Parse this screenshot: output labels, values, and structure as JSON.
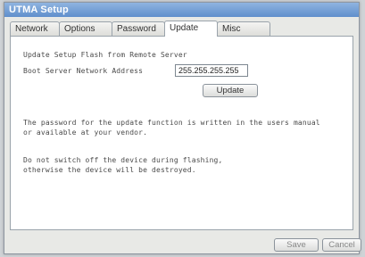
{
  "window": {
    "title": "UTMA Setup"
  },
  "tabs": [
    {
      "label": "Network"
    },
    {
      "label": "Options"
    },
    {
      "label": "Password"
    },
    {
      "label": "Update"
    },
    {
      "label": "Misc"
    }
  ],
  "active_tab": "Update",
  "update": {
    "heading": "Update Setup Flash from Remote Server",
    "address_label": "Boot Server Network Address",
    "address_value": "255.255.255.255",
    "update_button": "Update",
    "note1_line1": "The password for the update function is written in the users manual",
    "note1_line2": "or available at your vendor.",
    "note2_line1": "Do not switch off the device during flashing,",
    "note2_line2": "otherwise the device will be destroyed."
  },
  "footer": {
    "save_label": "Save",
    "cancel_label": "Cancel"
  }
}
